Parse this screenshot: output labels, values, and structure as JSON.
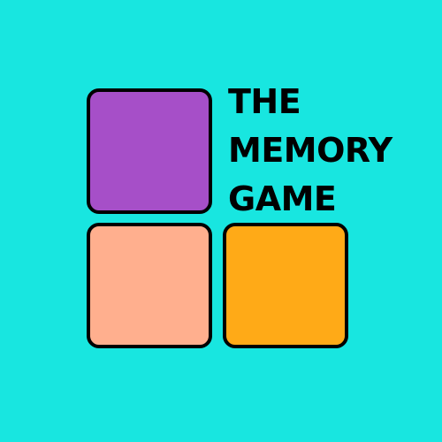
{
  "background_color": "#18e6e0",
  "title": {
    "lines": [
      "THE",
      "MEMORY",
      "GAME"
    ]
  },
  "tiles": [
    {
      "name": "purple",
      "color": "#a64fc8"
    },
    {
      "name": "peach",
      "color": "#ffaf8e"
    },
    {
      "name": "orange",
      "color": "#ffaa17"
    }
  ]
}
